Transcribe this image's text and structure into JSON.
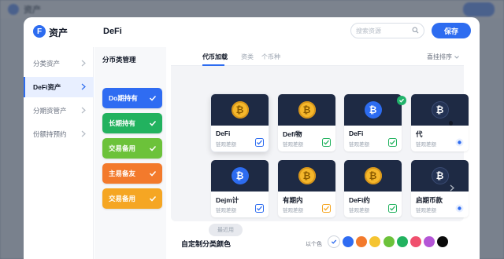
{
  "background": {
    "app_title": "资产"
  },
  "modal": {
    "brand": {
      "logo_letter": "F",
      "name": "资产"
    },
    "title": "DeFi",
    "search": {
      "placeholder": "搜索资源"
    },
    "save_label": "保存"
  },
  "leftnav": {
    "items": [
      {
        "label": "分类资产",
        "active": false
      },
      {
        "label": "DeFi资产",
        "active": true
      },
      {
        "label": "分期资管产",
        "active": false
      },
      {
        "label": "份额持预约",
        "active": false
      }
    ]
  },
  "categories": {
    "title": "分币类管理",
    "items": [
      {
        "label": "Do期持有",
        "color": "#2f6cf2"
      },
      {
        "label": "长期持有",
        "color": "#22b25f"
      },
      {
        "label": "交易备用",
        "color": "#6cc23a"
      },
      {
        "label": "主易备友",
        "color": "#f37a2c"
      },
      {
        "label": "交易备用",
        "color": "#f5a623"
      }
    ]
  },
  "main": {
    "tabs": [
      {
        "label": "代币加载",
        "active": true
      },
      {
        "label": "资类",
        "active": false
      },
      {
        "label": "个币种",
        "active": false
      }
    ],
    "sort_label": "喜挂排序",
    "cards": [
      {
        "name": "DeFi",
        "sub": "链观差额",
        "coin": "gold",
        "symbol": "₿",
        "check": "blue",
        "selected": true
      },
      {
        "name": "Defi物",
        "sub": "链观差额",
        "coin": "gold",
        "symbol": "₿",
        "check": "green",
        "selected": false
      },
      {
        "name": "DeFi",
        "sub": "链观差额",
        "coin": "blue",
        "symbol": "₿",
        "check": "green",
        "badge": true,
        "selected": false
      },
      {
        "name": "代",
        "sub": "链观差额",
        "coin": "navy",
        "symbol": "₿",
        "check": "dot",
        "selected": false
      },
      {
        "name": "Dejm计",
        "sub": "链观差额",
        "coin": "blue",
        "symbol": "₿",
        "check": "blue",
        "selected": false
      },
      {
        "name": "有期内",
        "sub": "链观差额",
        "coin": "gold",
        "symbol": "₿",
        "check": "orange",
        "selected": false
      },
      {
        "name": "DeFi约",
        "sub": "链观差额",
        "coin": "gold",
        "symbol": "₿",
        "check": "green",
        "selected": false
      },
      {
        "name": "启期币款",
        "sub": "链观差额",
        "coin": "navy",
        "symbol": "₿",
        "check": "dot",
        "selected": false
      }
    ],
    "load_more_label": "最近用"
  },
  "colors": {
    "title": "自定制分类颜色",
    "more_label": "以个色",
    "swatches": [
      "#ffffff",
      "#2f6cf2",
      "#f37a2c",
      "#f5c431",
      "#6cc23a",
      "#22b25f",
      "#f0506e",
      "#b455d6",
      "#0a0a0a"
    ]
  }
}
